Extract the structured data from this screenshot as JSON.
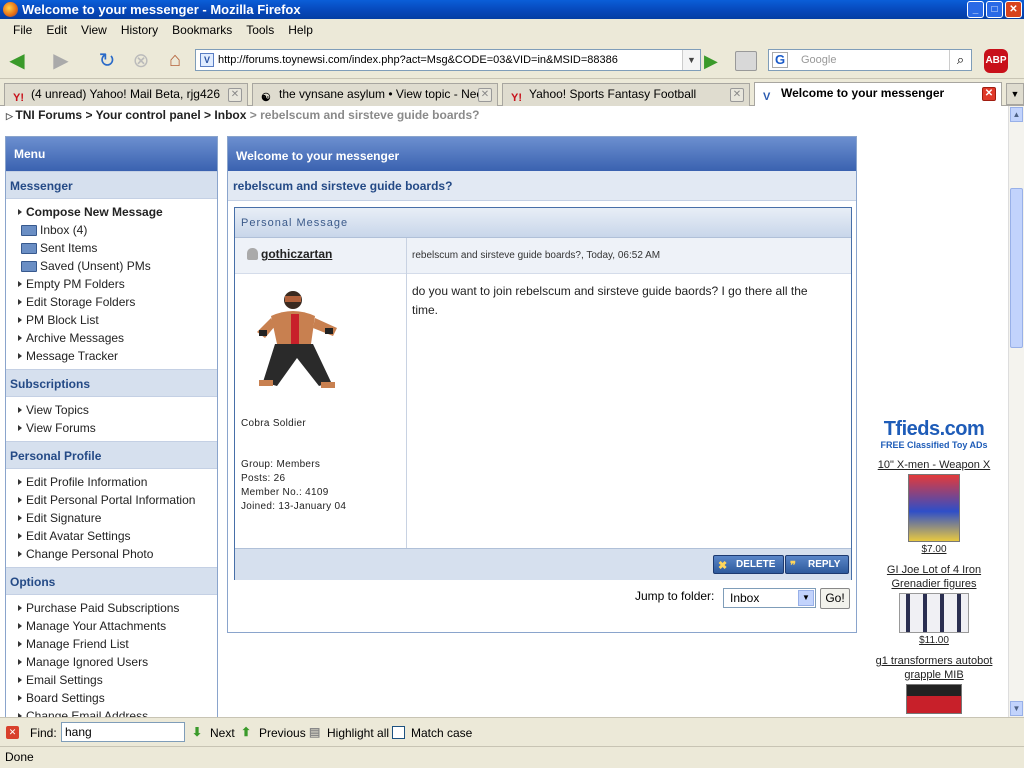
{
  "window": {
    "title": "Welcome to your messenger - Mozilla Firefox"
  },
  "menu": [
    "File",
    "Edit",
    "View",
    "History",
    "Bookmarks",
    "Tools",
    "Help"
  ],
  "nav": {
    "url": "http://forums.toynewsi.com/index.php?act=Msg&CODE=03&VID=in&MSID=88386",
    "search_placeholder": "Google",
    "abp_label": "ABP"
  },
  "tabs": [
    {
      "label": "(4 unread) Yahoo! Mail Beta, rjg426",
      "favicon": "Y!"
    },
    {
      "label": "the vynsane asylum • View topic - Nee...",
      "favicon": "☯"
    },
    {
      "label": "Yahoo! Sports Fantasy Football",
      "favicon": "Y!"
    },
    {
      "label": "Welcome to your messenger",
      "favicon": "V"
    }
  ],
  "breadcrumb": {
    "items": [
      "TNI Forums",
      "Your control panel",
      "Inbox"
    ],
    "current": "rebelscum and sirsteve guide boards?",
    "sep": ">"
  },
  "sidebar": {
    "title": "Menu",
    "sections": [
      {
        "title": "Messenger"
      },
      {
        "title": "Subscriptions"
      },
      {
        "title": "Personal Profile"
      },
      {
        "title": "Options"
      }
    ],
    "messenger": [
      "Compose New Message",
      "Inbox (4)",
      "Sent Items",
      "Saved (Unsent) PMs",
      "Empty PM Folders",
      "Edit Storage Folders",
      "PM Block List",
      "Archive Messages",
      "Message Tracker"
    ],
    "subscriptions": [
      "View Topics",
      "View Forums"
    ],
    "profile": [
      "Edit Profile Information",
      "Edit Personal Portal Information",
      "Edit Signature",
      "Edit Avatar Settings",
      "Change Personal Photo"
    ],
    "options": [
      "Purchase Paid Subscriptions",
      "Manage Your Attachments",
      "Manage Friend List",
      "Manage Ignored Users",
      "Email Settings",
      "Board Settings",
      "Change Email Address"
    ]
  },
  "main": {
    "title": "Welcome to your messenger",
    "subject": "rebelscum and sirsteve guide boards?",
    "pm_header": "Personal Message",
    "author": "gothiczartan",
    "meta": "rebelscum and sirsteve guide boards?, Today, 06:52 AM",
    "body": "do you want to join rebelscum and sirsteve guide baords? I go there all the time.",
    "rank": "Cobra Soldier",
    "group": "Group: Members",
    "posts": "Posts: 26",
    "member_no": "Member No.: 4109",
    "joined": "Joined: 13-January 04",
    "delete_label": "DELETE",
    "reply_label": "REPLY",
    "jump_label": "Jump to folder:",
    "jump_value": "Inbox",
    "go_label": "Go!"
  },
  "ads": {
    "logo": "Tfieds.com",
    "tagline": "FREE Classified Toy ADs",
    "items": [
      {
        "title": "10\" X-men - Weapon X",
        "price": "$7.00"
      },
      {
        "title": "GI Joe Lot of 4 Iron Grenadier figures",
        "price": "$11.00"
      },
      {
        "title": "g1 transformers autobot grapple MIB",
        "price": ""
      }
    ]
  },
  "find": {
    "label": "Find:",
    "value": "hang",
    "next": "Next",
    "previous": "Previous",
    "highlight": "Highlight all",
    "match_case": "Match case"
  },
  "status": {
    "text": "Done"
  }
}
